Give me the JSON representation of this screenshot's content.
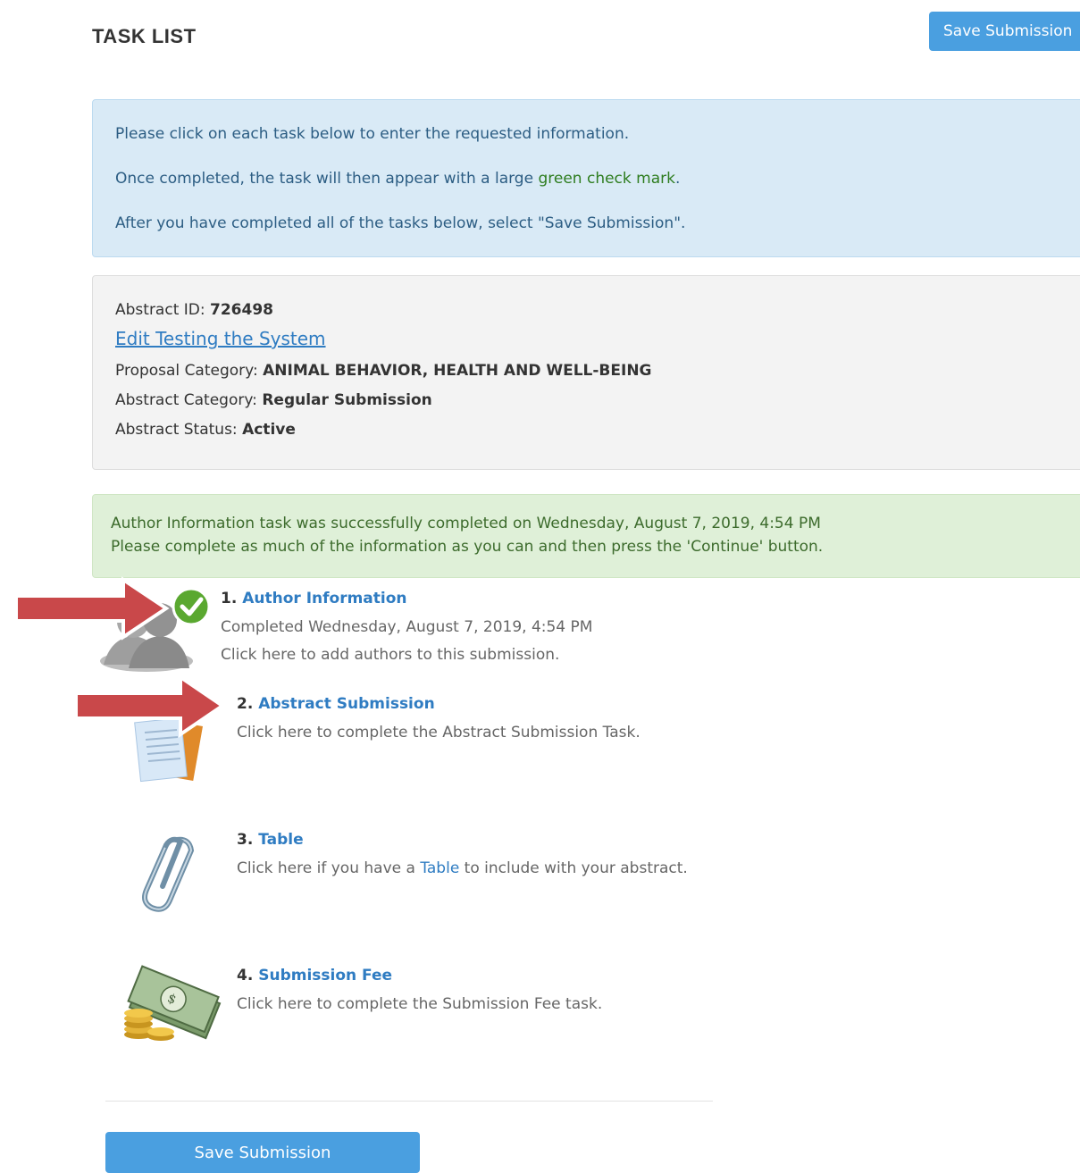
{
  "header": {
    "title": "TASK LIST",
    "save_label": "Save Submission"
  },
  "info": {
    "line1": "Please click on each task below to enter the requested information.",
    "line2_pre": "Once completed, the task will then appear with a large ",
    "line2_green": "green check mark",
    "line2_post": ".",
    "line3": "After you have completed all of the tasks below, select \"Save Submission\"."
  },
  "abstract": {
    "id_label": "Abstract ID: ",
    "id_value": "726498",
    "edit_link": "Edit Testing the System",
    "proposal_label": "Proposal Category: ",
    "proposal_value": "ANIMAL BEHAVIOR, HEALTH AND WELL-BEING",
    "category_label": "Abstract Category: ",
    "category_value": "Regular Submission",
    "status_label": "Abstract Status: ",
    "status_value": "Active"
  },
  "success": {
    "line1": "Author Information task was successfully completed on Wednesday, August 7, 2019, 4:54 PM",
    "line2": "Please complete as much of the information as you can and then press the 'Continue' button."
  },
  "tasks": [
    {
      "number": "1.",
      "title": "Author Information",
      "completed": "Completed Wednesday, August 7, 2019, 4:54 PM",
      "description": "Click here to add authors to this submission.",
      "icon": "authors-icon"
    },
    {
      "number": "2.",
      "title": "Abstract Submission",
      "description": "Click here to complete the Abstract Submission Task.",
      "icon": "document-icon"
    },
    {
      "number": "3.",
      "title": "Table",
      "description_pre": "Click here if you have a ",
      "description_link": "Table",
      "description_post": " to include with your abstract.",
      "icon": "paperclip-icon"
    },
    {
      "number": "4.",
      "title": "Submission Fee",
      "description": "Click here to complete the Submission Fee task.",
      "icon": "money-icon"
    }
  ],
  "footer": {
    "save_label": "Save Submission"
  },
  "colors": {
    "primary_button": "#4a9fe0",
    "link": "#2f7cc2",
    "info_bg": "#d9eaf6",
    "success_bg": "#dff0d8",
    "annotation_arrow": "#c9484a",
    "check": "#5aa830"
  }
}
